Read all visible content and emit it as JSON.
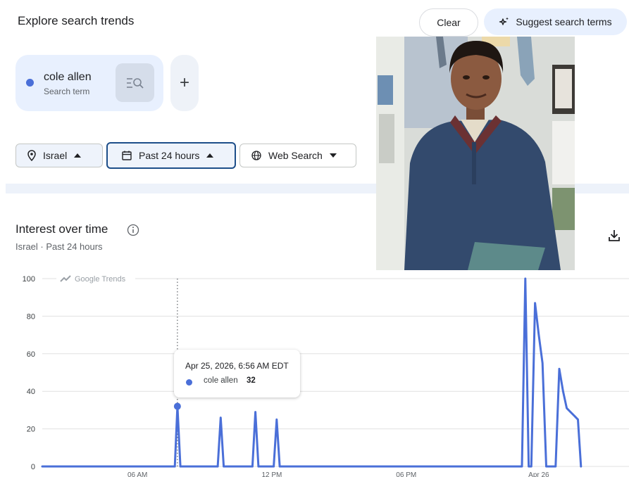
{
  "header": {
    "title": "Explore search trends",
    "clear_label": "Clear",
    "suggest_label": "Suggest search terms"
  },
  "term": {
    "name": "cole allen",
    "subtitle": "Search term",
    "color": "#4a6fd8"
  },
  "filters": {
    "location": "Israel",
    "time_range": "Past 24 hours",
    "property": "Web Search"
  },
  "section": {
    "title": "Interest over time",
    "subtitle": "Israel · Past 24 hours"
  },
  "watermark": "Google Trends",
  "tooltip": {
    "date": "Apr 25, 2026, 6:56 AM EDT",
    "series": "cole allen",
    "value": "32"
  },
  "colors": {
    "line": "#4a6fd8",
    "accent_bg": "#e8f0fe",
    "selected_border": "#1d4e89"
  },
  "chart_data": {
    "type": "line",
    "y_ticks": [
      "100",
      "80",
      "60",
      "40",
      "20",
      "0"
    ],
    "x_ticks": [
      "06 AM",
      "12 PM",
      "06 PM",
      "Apr 26"
    ],
    "ylim": [
      0,
      100
    ],
    "grid": true,
    "hover_point": {
      "x": "6:56 AM",
      "y": 32
    },
    "series": [
      {
        "name": "cole allen",
        "points": [
          [
            0,
            0
          ],
          [
            35.5,
            0
          ],
          [
            36.2,
            32
          ],
          [
            37,
            0
          ],
          [
            47,
            0
          ],
          [
            47.8,
            26
          ],
          [
            48.6,
            0
          ],
          [
            56.3,
            0
          ],
          [
            57.1,
            29
          ],
          [
            57.9,
            0
          ],
          [
            62,
            0
          ],
          [
            62.8,
            25
          ],
          [
            63.6,
            0
          ],
          [
            128.5,
            0
          ],
          [
            129.4,
            100
          ],
          [
            130.3,
            0
          ],
          [
            131,
            0
          ],
          [
            132,
            87
          ],
          [
            133,
            70
          ],
          [
            134,
            55
          ],
          [
            135,
            0
          ],
          [
            137.5,
            0
          ],
          [
            138.5,
            52
          ],
          [
            139.5,
            40
          ],
          [
            140.5,
            31
          ],
          [
            141.5,
            29
          ],
          [
            142.5,
            27
          ],
          [
            143.5,
            25
          ],
          [
            144.3,
            0
          ]
        ]
      }
    ]
  },
  "icons": [
    "location-pin-icon",
    "calendar-icon",
    "globe-icon",
    "caret-up-icon",
    "caret-down-icon",
    "info-icon",
    "download-icon",
    "sparkle-icon",
    "search-list-icon",
    "plus-icon",
    "trends-logo-icon"
  ]
}
